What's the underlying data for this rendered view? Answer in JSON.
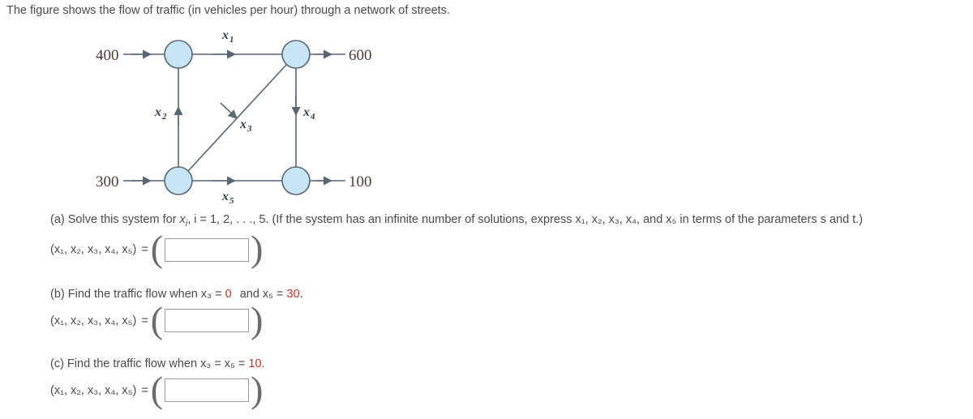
{
  "prompt": "The figure shows the flow of traffic (in vehicles per hour) through a network of streets.",
  "figure": {
    "inflow_top_left": "400",
    "outflow_top_right": "600",
    "inflow_bottom_left": "300",
    "outflow_bottom_right": "100",
    "edges": [
      {
        "var": "x",
        "sub": "1",
        "label": "x₁",
        "from": "top-left-node",
        "to": "top-right-node",
        "direction": "right"
      },
      {
        "var": "x",
        "sub": "2",
        "label": "x₂",
        "from": "bottom-left-node",
        "to": "top-left-node",
        "direction": "up"
      },
      {
        "var": "x",
        "sub": "3",
        "label": "x₃",
        "from": "bottom-left-node",
        "to": "top-right-node",
        "direction": "up-right"
      },
      {
        "var": "x",
        "sub": "4",
        "label": "x₄",
        "from": "top-right-node",
        "to": "bottom-right-node",
        "direction": "down"
      },
      {
        "var": "x",
        "sub": "5",
        "label": "x₅",
        "from": "bottom-left-node",
        "to": "bottom-right-node",
        "direction": "right"
      }
    ],
    "node_fill": "#c7e5f5",
    "node_stroke": "#5a6670",
    "line_color": "#5a6670"
  },
  "parts": {
    "a": {
      "line1_pre": "(a) Solve this system for ",
      "line1_var": "x",
      "line1_varsub": "i",
      "line1_mid": ", i = 1, 2, . . ., 5.  (If the system has an infinite number of solutions, express ",
      "line1_vars": "x₁, x₂, x₃, x₄, and x₅",
      "line1_post": " in terms of the parameters s and t.)",
      "tuple_label": "(x₁, x₂, x₃, x₄, x₅)",
      "equals": "=",
      "answer_value": "",
      "answer_placeholder": ""
    },
    "b": {
      "line1_pre": "(b) Find the traffic flow when ",
      "cond1_var": "x₃",
      "cond1_eq": " = ",
      "cond1_val": "0",
      "cond_join": " and ",
      "cond2_var": "x₅",
      "cond2_eq": " = ",
      "cond2_val": "30",
      "line1_end": ".",
      "tuple_label": "(x₁, x₂, x₃, x₄, x₅)",
      "equals": "=",
      "answer_value": "",
      "answer_placeholder": ""
    },
    "c": {
      "line1_pre": "(c) Find the traffic flow when ",
      "cond1_var": "x₃",
      "cond1_eq": " = ",
      "cond2_var": "x₅",
      "cond2_eq": " = ",
      "cond_val": "10",
      "line1_end": ".",
      "tuple_label": "(x₁, x₂, x₃, x₄, x₅)",
      "equals": "=",
      "answer_value": "",
      "answer_placeholder": ""
    }
  }
}
